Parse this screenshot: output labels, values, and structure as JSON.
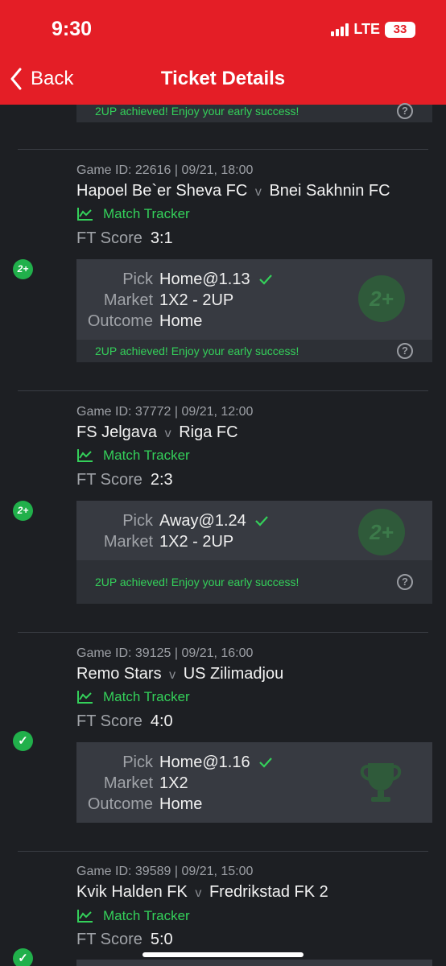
{
  "status_bar": {
    "time": "9:30",
    "network": "LTE",
    "battery": "33"
  },
  "nav": {
    "back_label": "Back",
    "title": "Ticket Details"
  },
  "top_partial": {
    "footer_msg": "2UP achieved! Enjoy your early success!"
  },
  "labels": {
    "match_tracker": "Match Tracker",
    "ft_score": "FT Score",
    "pick": "Pick",
    "market": "Market",
    "outcome": "Outcome",
    "versus": "v"
  },
  "games": [
    {
      "meta": "Game ID: 22616 | 09/21, 18:00",
      "home": "Hapoel Be`er Sheva FC",
      "away": "Bnei Sakhnin FC",
      "ft_score": "3:1",
      "badge": "2+",
      "pick": "Home@1.13",
      "market": "1X2 - 2UP",
      "outcome": "Home",
      "footer_msg": "2UP achieved! Enjoy your early success!"
    },
    {
      "meta": "Game ID: 37772 | 09/21, 12:00",
      "home": "FS Jelgava",
      "away": "Riga FC",
      "ft_score": "2:3",
      "badge": "2+",
      "pick": "Away@1.24",
      "market": "1X2 - 2UP",
      "footer_msg": "2UP achieved! Enjoy your early success!"
    },
    {
      "meta": "Game ID: 39125 | 09/21, 16:00",
      "home": "Remo Stars",
      "away": "US Zilimadjou",
      "ft_score": "4:0",
      "badge": "✓",
      "pick": "Home@1.16",
      "market": "1X2",
      "outcome": "Home"
    },
    {
      "meta": "Game ID: 39589 | 09/21, 15:00",
      "home": "Kvik Halden FK",
      "away": "Fredrikstad FK 2",
      "ft_score": "5:0",
      "badge": "✓"
    }
  ],
  "colors": {
    "header_red": "#e41e26",
    "success_green": "#34d05a",
    "badge_green": "#21b04b",
    "background": "#1d1f23",
    "card": "#373a41"
  }
}
